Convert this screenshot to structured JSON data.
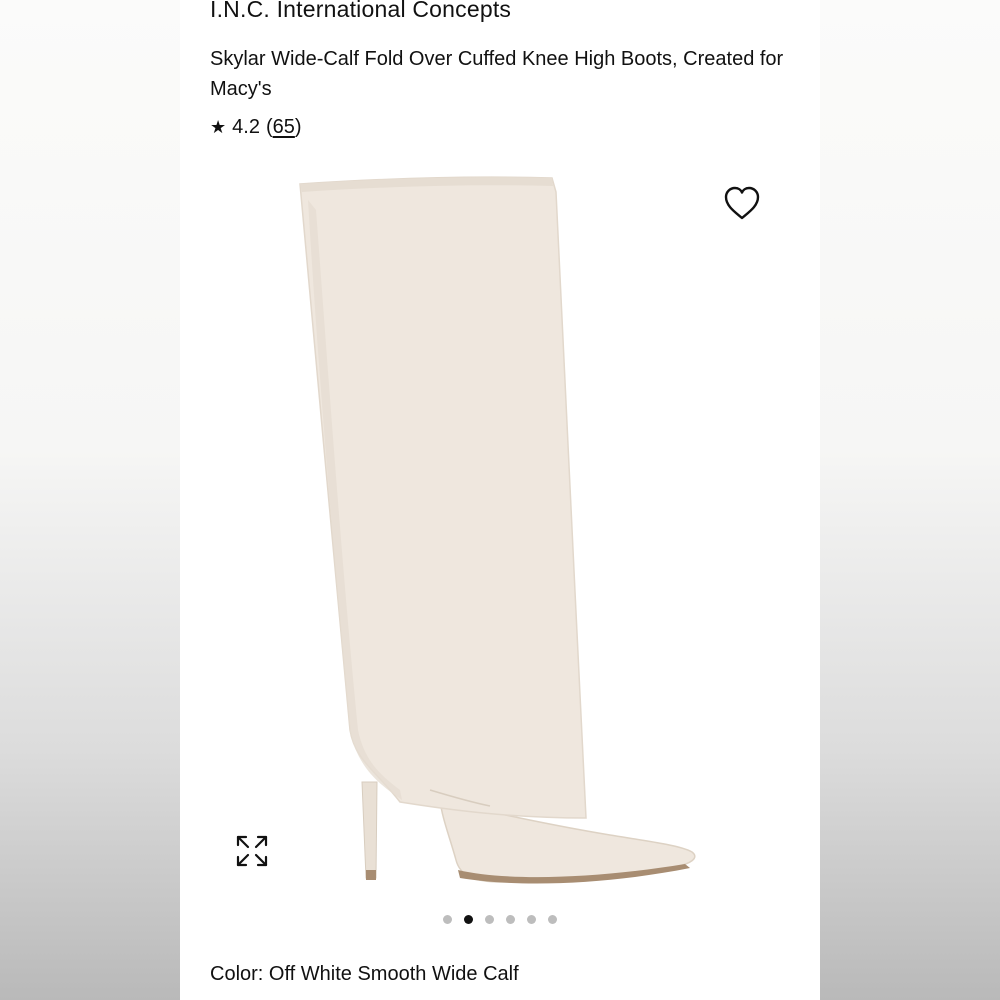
{
  "product": {
    "brand": "I.N.C. International Concepts",
    "title": "Skylar Wide-Calf Fold Over Cuffed Knee High Boots, Created for Macy's",
    "rating": {
      "star": "★",
      "value": "4.2",
      "open_paren": "(",
      "count": "65",
      "close_paren": ")"
    },
    "color_label": "Color:",
    "color_value": "Off White Smooth Wide Calf"
  },
  "gallery": {
    "slide_count": 6,
    "active_index": 1,
    "icons": {
      "wishlist": "heart-outline-icon",
      "expand": "expand-arrows-icon"
    }
  },
  "colors": {
    "boot": "#efe7de",
    "boot_shade": "#e6ddd2",
    "sole": "#a88d72",
    "text": "#111111",
    "dot_inactive": "#bdbdbd",
    "dot_active": "#111111"
  }
}
